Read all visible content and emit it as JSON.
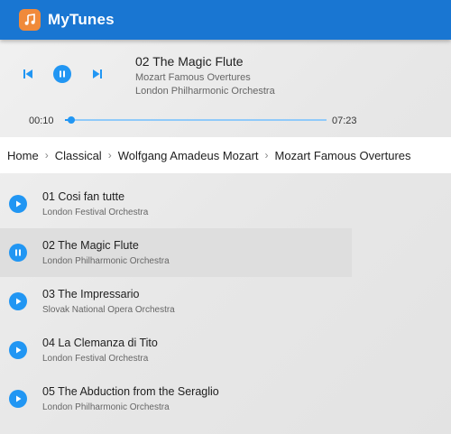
{
  "app": {
    "title": "MyTunes",
    "logo_icon": "music-note-icon",
    "brand_color": "#1976d2",
    "accent_color": "#2196f3",
    "logo_color": "#f08a3a"
  },
  "player": {
    "now_playing": {
      "title": "02 The Magic Flute",
      "album": "Mozart Famous Overtures",
      "artist": "London Philharmonic Orchestra"
    },
    "controls": {
      "previous_icon": "skip-previous-icon",
      "play_pause_icon": "pause-icon",
      "next_icon": "skip-next-icon"
    },
    "progress": {
      "current": "00:10",
      "total": "07:23",
      "fraction": 0.023
    }
  },
  "breadcrumb": [
    "Home",
    "Classical",
    "Wolfgang Amadeus Mozart",
    "Mozart Famous Overtures"
  ],
  "tracks": [
    {
      "title": "01 Cosi fan tutte",
      "artist": "London Festival Orchestra",
      "state": "play"
    },
    {
      "title": "02 The Magic Flute",
      "artist": "London Philharmonic Orchestra",
      "state": "pause"
    },
    {
      "title": "03 The Impressario",
      "artist": "Slovak National Opera Orchestra",
      "state": "play"
    },
    {
      "title": "04 La Clemanza di Tito",
      "artist": "London Festival Orchestra",
      "state": "play"
    },
    {
      "title": "05 The Abduction from the Seraglio",
      "artist": "London Philharmonic Orchestra",
      "state": "play"
    }
  ]
}
